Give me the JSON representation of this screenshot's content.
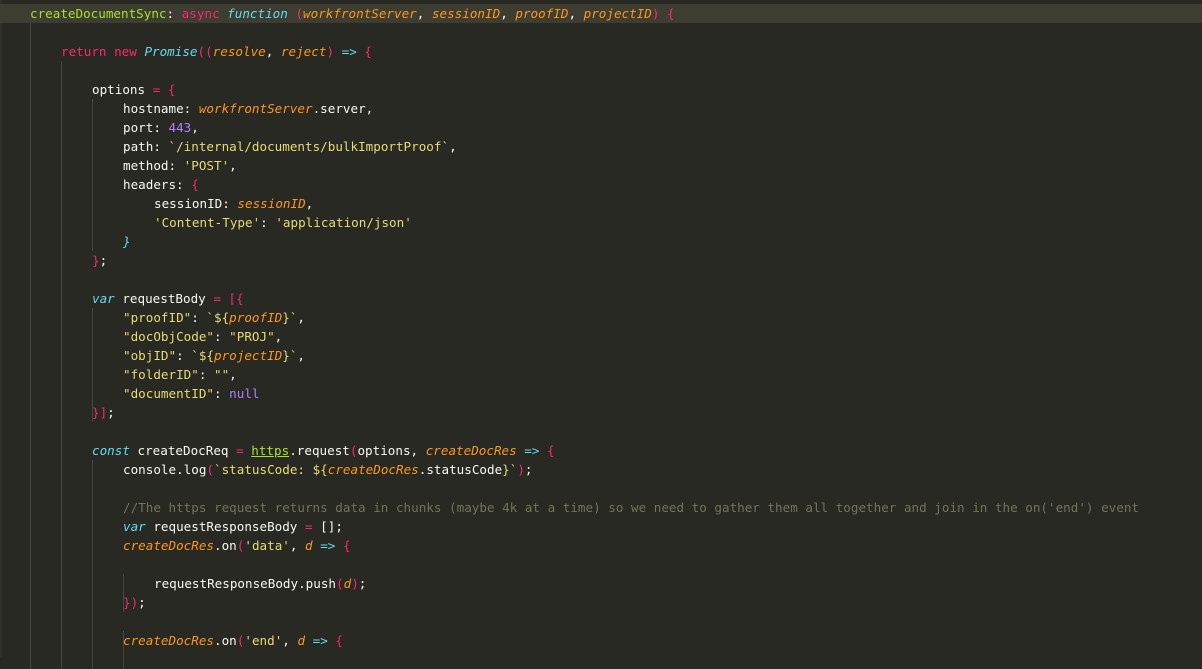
{
  "colors": {
    "background": "#282923",
    "current_line": "#3e3d32",
    "keyword": "#f92672",
    "storage": "#66d9ef",
    "function_name": "#a6e22e",
    "parameter": "#fd971f",
    "string": "#e6db74",
    "number": "#ae81ff",
    "comment": "#75715e",
    "text": "#f8f8f2"
  },
  "code_lines": [
    {
      "indent": 0,
      "current": true,
      "tokens": [
        {
          "t": "createDocumentSync",
          "c": "fn"
        },
        {
          "t": ": ",
          "c": "plain"
        },
        {
          "t": "async",
          "c": "kw"
        },
        {
          "t": " ",
          "c": "plain"
        },
        {
          "t": "function",
          "c": "st"
        },
        {
          "t": " ",
          "c": "plain"
        },
        {
          "t": "(",
          "c": "br"
        },
        {
          "t": "workfrontServer",
          "c": "par"
        },
        {
          "t": ", ",
          "c": "plain"
        },
        {
          "t": "sessionID",
          "c": "par"
        },
        {
          "t": ", ",
          "c": "plain"
        },
        {
          "t": "proofID",
          "c": "par"
        },
        {
          "t": ", ",
          "c": "plain"
        },
        {
          "t": "projectID",
          "c": "par"
        },
        {
          "t": ") {",
          "c": "br"
        }
      ]
    },
    {
      "indent": 0,
      "tokens": []
    },
    {
      "indent": 1,
      "tokens": [
        {
          "t": "return",
          "c": "kw"
        },
        {
          "t": " ",
          "c": "plain"
        },
        {
          "t": "new",
          "c": "kw"
        },
        {
          "t": " ",
          "c": "plain"
        },
        {
          "t": "Promise",
          "c": "cls"
        },
        {
          "t": "((",
          "c": "br"
        },
        {
          "t": "resolve",
          "c": "par_plain"
        },
        {
          "t": ", ",
          "c": "plain"
        },
        {
          "t": "reject",
          "c": "par_plain"
        },
        {
          "t": ") ",
          "c": "br"
        },
        {
          "t": "=>",
          "c": "st_plain"
        },
        {
          "t": " {",
          "c": "br"
        }
      ]
    },
    {
      "indent": 0,
      "tokens": []
    },
    {
      "indent": 2,
      "tokens": [
        {
          "t": "options",
          "c": "plain"
        },
        {
          "t": " = ",
          "c": "kw"
        },
        {
          "t": "{",
          "c": "br"
        }
      ]
    },
    {
      "indent": 3,
      "tokens": [
        {
          "t": "hostname",
          "c": "plain"
        },
        {
          "t": ": ",
          "c": "plain"
        },
        {
          "t": "workfrontServer",
          "c": "par"
        },
        {
          "t": ".server,",
          "c": "plain"
        }
      ]
    },
    {
      "indent": 3,
      "tokens": [
        {
          "t": "port",
          "c": "plain"
        },
        {
          "t": ": ",
          "c": "plain"
        },
        {
          "t": "443",
          "c": "num"
        },
        {
          "t": ",",
          "c": "plain"
        }
      ]
    },
    {
      "indent": 3,
      "tokens": [
        {
          "t": "path",
          "c": "plain"
        },
        {
          "t": ": ",
          "c": "plain"
        },
        {
          "t": "`/internal/documents/bulkImportProof`",
          "c": "str"
        },
        {
          "t": ",",
          "c": "plain"
        }
      ]
    },
    {
      "indent": 3,
      "tokens": [
        {
          "t": "method",
          "c": "plain"
        },
        {
          "t": ": ",
          "c": "plain"
        },
        {
          "t": "'POST'",
          "c": "str"
        },
        {
          "t": ",",
          "c": "plain"
        }
      ]
    },
    {
      "indent": 3,
      "tokens": [
        {
          "t": "headers",
          "c": "plain"
        },
        {
          "t": ": ",
          "c": "plain"
        },
        {
          "t": "{",
          "c": "br"
        }
      ]
    },
    {
      "indent": 4,
      "tokens": [
        {
          "t": "sessionID",
          "c": "plain"
        },
        {
          "t": ": ",
          "c": "plain"
        },
        {
          "t": "sessionID",
          "c": "par"
        },
        {
          "t": ",",
          "c": "plain"
        }
      ]
    },
    {
      "indent": 4,
      "tokens": [
        {
          "t": "'Content-Type'",
          "c": "str"
        },
        {
          "t": ": ",
          "c": "plain"
        },
        {
          "t": "'application/json'",
          "c": "str"
        }
      ]
    },
    {
      "indent": 3,
      "tokens": [
        {
          "t": "}",
          "c": "storage_br"
        }
      ]
    },
    {
      "indent": 2,
      "tokens": [
        {
          "t": "}",
          "c": "br"
        },
        {
          "t": ";",
          "c": "plain"
        }
      ]
    },
    {
      "indent": 0,
      "tokens": []
    },
    {
      "indent": 2,
      "tokens": [
        {
          "t": "var",
          "c": "st"
        },
        {
          "t": " requestBody ",
          "c": "plain"
        },
        {
          "t": "=",
          "c": "kw"
        },
        {
          "t": " [{",
          "c": "br"
        }
      ]
    },
    {
      "indent": 3,
      "tokens": [
        {
          "t": "\"proofID\"",
          "c": "str"
        },
        {
          "t": ": ",
          "c": "plain"
        },
        {
          "t": "`${",
          "c": "str"
        },
        {
          "t": "proofID",
          "c": "par"
        },
        {
          "t": "}`",
          "c": "str"
        },
        {
          "t": ",",
          "c": "plain"
        }
      ]
    },
    {
      "indent": 3,
      "tokens": [
        {
          "t": "\"docObjCode\"",
          "c": "str"
        },
        {
          "t": ": ",
          "c": "plain"
        },
        {
          "t": "\"PROJ\"",
          "c": "str"
        },
        {
          "t": ",",
          "c": "plain"
        }
      ]
    },
    {
      "indent": 3,
      "tokens": [
        {
          "t": "\"objID\"",
          "c": "str"
        },
        {
          "t": ": ",
          "c": "plain"
        },
        {
          "t": "`${",
          "c": "str"
        },
        {
          "t": "projectID",
          "c": "par"
        },
        {
          "t": "}`",
          "c": "str"
        },
        {
          "t": ",",
          "c": "plain"
        }
      ]
    },
    {
      "indent": 3,
      "tokens": [
        {
          "t": "\"folderID\"",
          "c": "str"
        },
        {
          "t": ": ",
          "c": "plain"
        },
        {
          "t": "\"\"",
          "c": "str"
        },
        {
          "t": ",",
          "c": "plain"
        }
      ]
    },
    {
      "indent": 3,
      "tokens": [
        {
          "t": "\"documentID\"",
          "c": "str"
        },
        {
          "t": ": ",
          "c": "plain"
        },
        {
          "t": "null",
          "c": "num"
        }
      ]
    },
    {
      "indent": 2,
      "tokens": [
        {
          "t": "}]",
          "c": "br"
        },
        {
          "t": ";",
          "c": "plain"
        }
      ]
    },
    {
      "indent": 0,
      "tokens": []
    },
    {
      "indent": 2,
      "tokens": [
        {
          "t": "const",
          "c": "st"
        },
        {
          "t": " createDocReq ",
          "c": "plain"
        },
        {
          "t": "=",
          "c": "kw"
        },
        {
          "t": " ",
          "c": "plain"
        },
        {
          "t": "https",
          "c": "ul"
        },
        {
          "t": ".",
          "c": "plain"
        },
        {
          "t": "request",
          "c": "plain"
        },
        {
          "t": "(",
          "c": "br"
        },
        {
          "t": "options",
          "c": "plain"
        },
        {
          "t": ", ",
          "c": "plain"
        },
        {
          "t": "createDocRes",
          "c": "par"
        },
        {
          "t": " ",
          "c": "plain"
        },
        {
          "t": "=>",
          "c": "st_plain"
        },
        {
          "t": " {",
          "c": "br"
        }
      ]
    },
    {
      "indent": 3,
      "tokens": [
        {
          "t": "console",
          "c": "plain"
        },
        {
          "t": ".",
          "c": "plain"
        },
        {
          "t": "log",
          "c": "plain"
        },
        {
          "t": "(",
          "c": "br"
        },
        {
          "t": "`statusCode: ${",
          "c": "str"
        },
        {
          "t": "createDocRes",
          "c": "par"
        },
        {
          "t": ".statusCode",
          "c": "plain"
        },
        {
          "t": "}`",
          "c": "str"
        },
        {
          "t": ")",
          "c": "br"
        },
        {
          "t": ";",
          "c": "plain"
        }
      ]
    },
    {
      "indent": 0,
      "tokens": []
    },
    {
      "indent": 3,
      "tokens": [
        {
          "t": "//The https request returns data in chunks (maybe 4k at a time) so we need to gather them all together and join in the on('end') event",
          "c": "com"
        }
      ]
    },
    {
      "indent": 3,
      "tokens": [
        {
          "t": "var",
          "c": "st"
        },
        {
          "t": " requestResponseBody ",
          "c": "plain"
        },
        {
          "t": "=",
          "c": "kw"
        },
        {
          "t": " [];",
          "c": "plain"
        }
      ]
    },
    {
      "indent": 3,
      "tokens": [
        {
          "t": "createDocRes",
          "c": "par"
        },
        {
          "t": ".",
          "c": "plain"
        },
        {
          "t": "on",
          "c": "plain"
        },
        {
          "t": "(",
          "c": "br"
        },
        {
          "t": "'data'",
          "c": "str"
        },
        {
          "t": ", ",
          "c": "plain"
        },
        {
          "t": "d",
          "c": "par"
        },
        {
          "t": " ",
          "c": "plain"
        },
        {
          "t": "=>",
          "c": "st_plain"
        },
        {
          "t": " {",
          "c": "br"
        }
      ]
    },
    {
      "indent": 0,
      "tokens": []
    },
    {
      "indent": 4,
      "tokens": [
        {
          "t": "requestResponseBody",
          "c": "plain"
        },
        {
          "t": ".",
          "c": "plain"
        },
        {
          "t": "push",
          "c": "plain"
        },
        {
          "t": "(",
          "c": "br"
        },
        {
          "t": "d",
          "c": "par"
        },
        {
          "t": ")",
          "c": "br"
        },
        {
          "t": ";",
          "c": "plain"
        }
      ]
    },
    {
      "indent": 3,
      "tokens": [
        {
          "t": "})",
          "c": "br"
        },
        {
          "t": ";",
          "c": "plain"
        }
      ]
    },
    {
      "indent": 0,
      "tokens": []
    },
    {
      "indent": 3,
      "tokens": [
        {
          "t": "createDocRes",
          "c": "par"
        },
        {
          "t": ".",
          "c": "plain"
        },
        {
          "t": "on",
          "c": "plain"
        },
        {
          "t": "(",
          "c": "br"
        },
        {
          "t": "'end'",
          "c": "str"
        },
        {
          "t": ", ",
          "c": "plain"
        },
        {
          "t": "d",
          "c": "par"
        },
        {
          "t": " ",
          "c": "plain"
        },
        {
          "t": "=>",
          "c": "st_plain"
        },
        {
          "t": " {",
          "c": "br"
        }
      ]
    }
  ]
}
